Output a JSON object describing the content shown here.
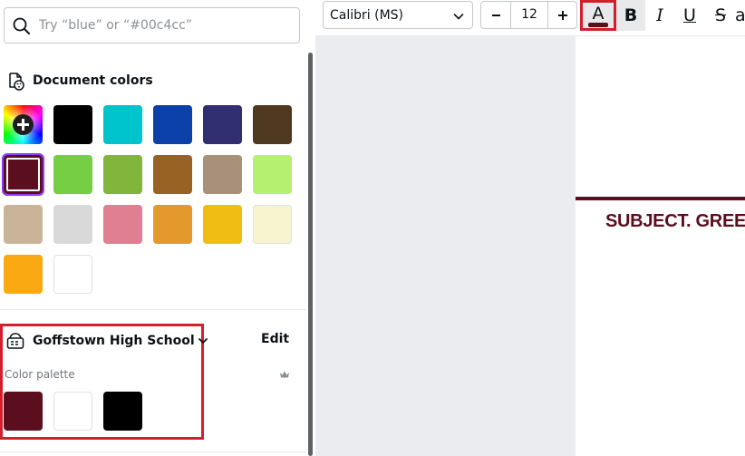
{
  "search": {
    "placeholder": "Try “blue” or “#00c4cc”"
  },
  "document_colors": {
    "title": "Document colors",
    "swatches": [
      {
        "color": "add",
        "selected": false
      },
      {
        "color": "#000000",
        "selected": false
      },
      {
        "color": "#00c4cc",
        "selected": false
      },
      {
        "color": "#0b40a8",
        "selected": false
      },
      {
        "color": "#312f72",
        "selected": false
      },
      {
        "color": "#4e381f",
        "selected": false
      },
      {
        "color": "#5a0e1e",
        "selected": true
      },
      {
        "color": "#76ce45",
        "selected": false
      },
      {
        "color": "#81b53b",
        "selected": false
      },
      {
        "color": "#986225",
        "selected": false
      },
      {
        "color": "#a8917a",
        "selected": false
      },
      {
        "color": "#b5f071",
        "selected": false
      },
      {
        "color": "#c9b49a",
        "selected": false
      },
      {
        "color": "#d9d9d9",
        "selected": false
      },
      {
        "color": "#e07f92",
        "selected": false
      },
      {
        "color": "#e3992c",
        "selected": false
      },
      {
        "color": "#efbd13",
        "selected": false
      },
      {
        "color": "#f7f4cf",
        "selected": false
      },
      {
        "color": "#fba912",
        "selected": false
      },
      {
        "color": "#ffffff",
        "selected": false
      }
    ]
  },
  "brand_kit": {
    "name": "Goffstown High School",
    "edit_label": "Edit",
    "palette_label": "Color palette",
    "swatches": [
      "#5a0e1e",
      "#ffffff",
      "#000000"
    ]
  },
  "toolbar": {
    "font_name": "Calibri (MS)",
    "font_size": "12",
    "text_color_letter": "A",
    "text_color": "#5a0e1e",
    "bold_label": "B",
    "italic_label": "I",
    "underline_label": "U",
    "strike_label": "S",
    "more_label": "a"
  },
  "canvas": {
    "text": "SUBJECT. GREE"
  },
  "colors": {
    "highlight": "#d21f2c",
    "selection": "#8b3dff"
  }
}
